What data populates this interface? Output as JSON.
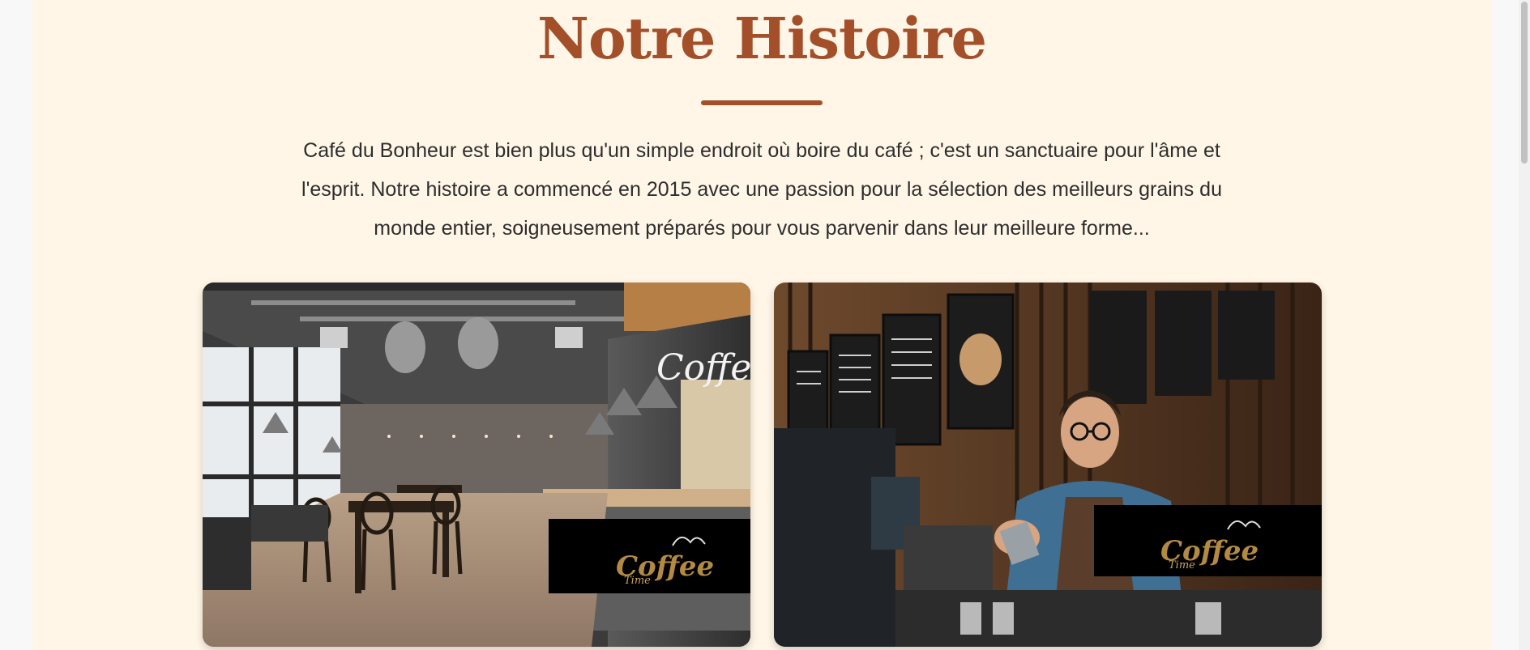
{
  "section": {
    "title": "Notre Histoire",
    "intro_lines": [
      "Café du Bonheur est bien plus qu'un simple endroit où boire du café ; c'est un sanctuaire pour l'âme et",
      "l'esprit. Notre histoire a commencé en 2015 avec une passion pour la sélection des meilleurs grains du",
      "monde entier, soigneusement préparés pour vous parvenir dans leur meilleure forme..."
    ]
  },
  "images": {
    "left": {
      "sign_text": "Coffee",
      "logo_script": "Coffee",
      "logo_small": "Time"
    },
    "right": {
      "logo_script": "Coffee",
      "logo_small": "Time"
    }
  },
  "colors": {
    "brand": "#a34f29",
    "background": "#fff6e7",
    "text": "#2d2d2d"
  }
}
